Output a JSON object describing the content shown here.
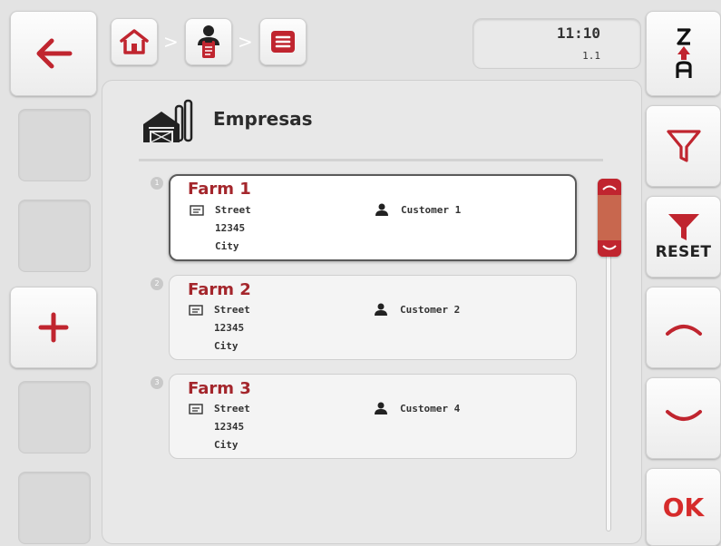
{
  "clock": {
    "time": "11:10",
    "version": "1.1"
  },
  "page": {
    "title": "Empresas"
  },
  "toolbar": {
    "reset_label": "RESET",
    "ok_label": "OK"
  },
  "icons": {
    "back": "arrow-left-icon",
    "add": "plus-icon",
    "home": "home-icon",
    "person": "person-clipboard-icon",
    "menu": "menu-icon",
    "sort": "sort-z-a-icon",
    "filter": "filter-icon",
    "reset": "filter-reset-icon",
    "up": "chevron-up-icon",
    "down": "chevron-down-icon",
    "title": "farm-buildings-icon"
  },
  "colors": {
    "accent": "#c0252f",
    "title_red": "#a4262c",
    "scroll_thumb": "#c8674e"
  },
  "farms": [
    {
      "number": "1",
      "name": "Farm 1",
      "street": "Street",
      "zip": "12345",
      "city": "City",
      "customer": "Customer 1",
      "selected": true
    },
    {
      "number": "2",
      "name": "Farm 2",
      "street": "Street",
      "zip": "12345",
      "city": "City",
      "customer": "Customer 2",
      "selected": false
    },
    {
      "number": "3",
      "name": "Farm 3",
      "street": "Street",
      "zip": "12345",
      "city": "City",
      "customer": "Customer 4",
      "selected": false
    }
  ]
}
